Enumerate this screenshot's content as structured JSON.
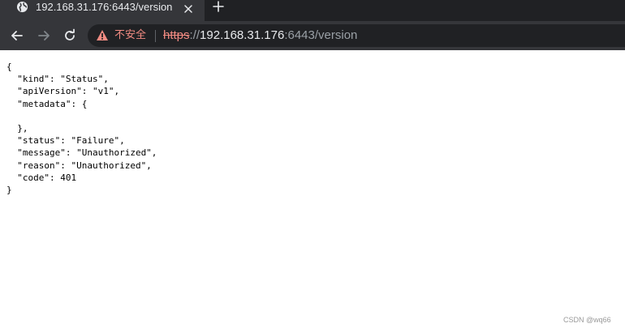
{
  "browser": {
    "tab": {
      "title": "192.168.31.176:6443/version",
      "favicon": "globe-icon",
      "close_icon": "close-icon"
    },
    "new_tab_icon": "plus-icon",
    "nav": {
      "back_icon": "arrow-left-icon",
      "forward_icon": "arrow-right-icon",
      "reload_icon": "reload-icon"
    },
    "omnibox": {
      "warning_icon": "warning-triangle-icon",
      "security_label": "不安全",
      "url_scheme": "https",
      "url_separator": "://",
      "url_host": "192.168.31.176",
      "url_rest": ":6443/version"
    },
    "colors": {
      "tab_strip": "#202124",
      "toolbar": "#35363a",
      "omnibox": "#202124",
      "warning": "#f28b82",
      "text_primary": "#e8eaed",
      "text_secondary": "#9aa0a6"
    }
  },
  "page": {
    "json_lines": [
      "{",
      "  \"kind\": \"Status\",",
      "  \"apiVersion\": \"v1\",",
      "  \"metadata\": {",
      "",
      "  },",
      "  \"status\": \"Failure\",",
      "  \"message\": \"Unauthorized\",",
      "  \"reason\": \"Unauthorized\",",
      "  \"code\": 401",
      "}"
    ]
  },
  "watermark": "CSDN @wq66"
}
